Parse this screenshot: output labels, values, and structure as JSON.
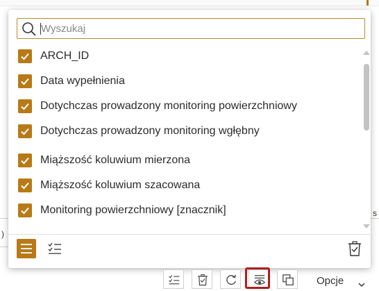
{
  "search": {
    "placeholder": "Wyszukaj",
    "value": ""
  },
  "fields": [
    {
      "label": "ARCH_ID",
      "checked": true
    },
    {
      "label": "Data wypełnienia",
      "checked": true
    },
    {
      "label": "Dotychczas prowadzony monitoring powierzchniowy",
      "checked": true
    },
    {
      "label": "Dotychczas prowadzony monitoring wgłębny",
      "checked": true
    },
    {
      "label": "Miąższość koluwium mierzona",
      "checked": true
    },
    {
      "label": "Miąższość koluwium szacowana",
      "checked": true
    },
    {
      "label": "Monitoring powierzchniowy [znacznik]",
      "checked": true
    }
  ],
  "background": {
    "left_fragment": ")",
    "right_fragment": "s"
  },
  "toolbar": {
    "options_label": "Opcje"
  },
  "colors": {
    "accent": "#b87a17",
    "highlight": "#b21c1c"
  }
}
